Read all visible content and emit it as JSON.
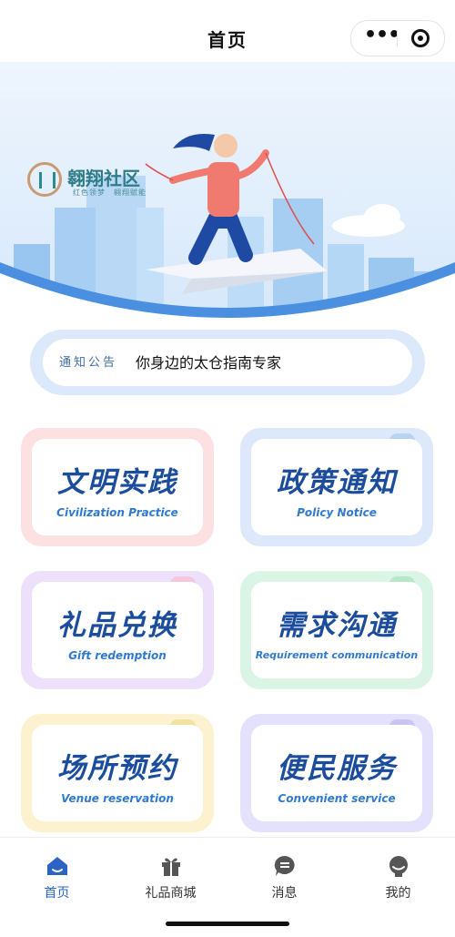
{
  "header": {
    "title": "首页"
  },
  "banner": {
    "logo_name": "翱翔社区",
    "logo_sub": "红色领梦　翱翔赋能"
  },
  "notice": {
    "tag": "通知公告",
    "text": "你身边的太仓指南专家"
  },
  "cards": [
    {
      "cn": "文明实践",
      "en": "Civilization Practice",
      "border": "#fde0e2",
      "tab": "#fde0e2"
    },
    {
      "cn": "政策通知",
      "en": "Policy Notice",
      "border": "#dde8fb",
      "tab": "#b9d3f5"
    },
    {
      "cn": "礼品兑换",
      "en": "Gift redemption",
      "border": "#ece0fb",
      "tab": "#f7c7e0"
    },
    {
      "cn": "需求沟通",
      "en": "Requirement communication",
      "border": "#daf5e6",
      "tab": "#b6e8c8"
    },
    {
      "cn": "场所预约",
      "en": "Venue reservation",
      "border": "#fdf2cf",
      "tab": "#f3e1a3"
    },
    {
      "cn": "便民服务",
      "en": "Convenient service",
      "border": "#e3e1fb",
      "tab": "#cbc5f3"
    }
  ],
  "tabbar": [
    {
      "label": "首页",
      "icon": "home-icon",
      "active": true
    },
    {
      "label": "礼品商城",
      "icon": "gift-icon",
      "active": false
    },
    {
      "label": "消息",
      "icon": "message-icon",
      "active": false
    },
    {
      "label": "我的",
      "icon": "profile-icon",
      "active": false
    }
  ]
}
